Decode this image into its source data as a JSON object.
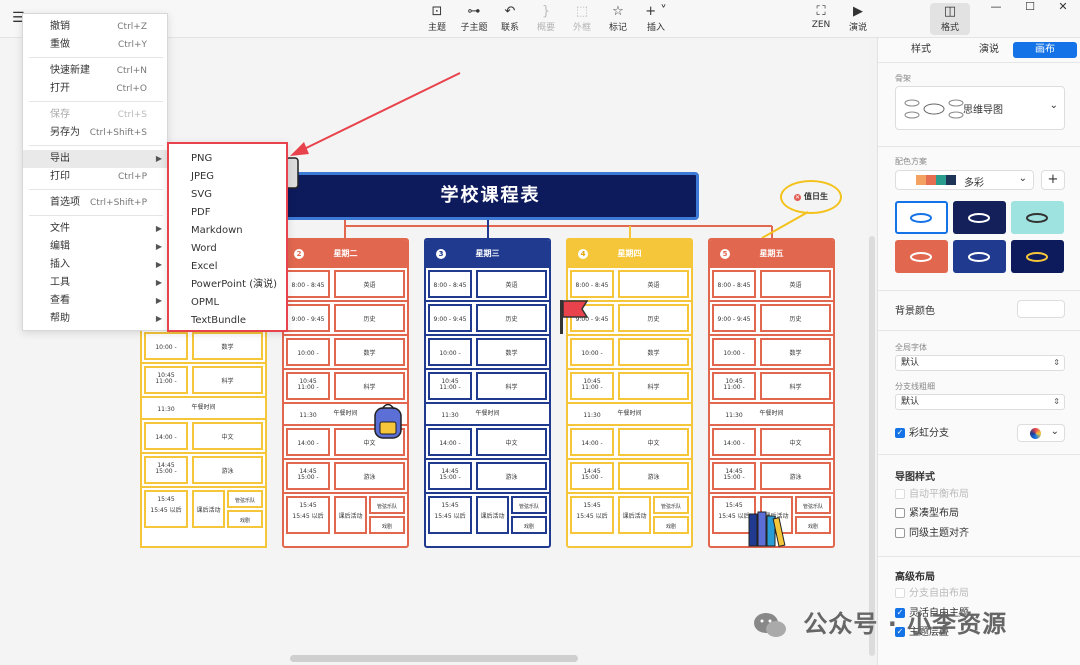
{
  "toolbar": {
    "buttons": [
      {
        "label": "主题",
        "icon": "topic-icon"
      },
      {
        "label": "子主题",
        "icon": "subtopic-icon"
      },
      {
        "label": "联系",
        "icon": "relationship-icon"
      },
      {
        "label": "概要",
        "icon": "summary-icon"
      },
      {
        "label": "外框",
        "icon": "boundary-icon"
      },
      {
        "label": "标记",
        "icon": "marker-icon"
      },
      {
        "label": "插入",
        "icon": "insert-icon"
      },
      {
        "label": "ZEN",
        "icon": "zen-icon"
      },
      {
        "label": "演说",
        "icon": "pitch-icon"
      },
      {
        "label": "格式",
        "icon": "format-icon"
      }
    ]
  },
  "menu": {
    "items": [
      {
        "label": "撤销",
        "shortcut": "Ctrl+Z"
      },
      {
        "label": "重做",
        "shortcut": "Ctrl+Y"
      },
      {
        "label": "快速新建",
        "shortcut": "Ctrl+N"
      },
      {
        "label": "打开",
        "shortcut": "Ctrl+O"
      },
      {
        "label": "保存",
        "shortcut": "Ctrl+S"
      },
      {
        "label": "另存为",
        "shortcut": "Ctrl+Shift+S"
      },
      {
        "label": "导出",
        "shortcut": ""
      },
      {
        "label": "打印",
        "shortcut": "Ctrl+P"
      },
      {
        "label": "首选项",
        "shortcut": "Ctrl+Shift+P"
      },
      {
        "label": "文件",
        "shortcut": ""
      },
      {
        "label": "编辑",
        "shortcut": ""
      },
      {
        "label": "插入",
        "shortcut": ""
      },
      {
        "label": "工具",
        "shortcut": ""
      },
      {
        "label": "查看",
        "shortcut": ""
      },
      {
        "label": "帮助",
        "shortcut": ""
      }
    ]
  },
  "export_submenu": {
    "items": [
      "PNG",
      "JPEG",
      "SVG",
      "PDF",
      "Markdown",
      "Word",
      "Excel",
      "PowerPoint (演说)",
      "OPML",
      "TextBundle"
    ]
  },
  "canvas": {
    "title": "学校课程表",
    "callout": "值日生",
    "days": [
      {
        "num": "2",
        "name": "星期二"
      },
      {
        "num": "3",
        "name": "星期三"
      },
      {
        "num": "4",
        "name": "星期四"
      },
      {
        "num": "5",
        "name": "星期五"
      }
    ],
    "times": [
      "8:00 - 8:45",
      "9:00 - 9:45",
      "10:00 - 10:45",
      "11:00 - 11:30",
      "14:00 - 14:45",
      "15:00 - 15:45",
      "15:45 以后"
    ],
    "subjects": [
      "英语",
      "历史",
      "数学",
      "科学",
      "中文",
      "游泳"
    ],
    "lunch": "午餐时间",
    "after": [
      "课后活动",
      "管弦乐队",
      "戏剧"
    ]
  },
  "panel": {
    "tabs": [
      "样式",
      "演说",
      "画布"
    ],
    "skeleton_label": "骨架",
    "skeleton_value": "思维导图",
    "color_label": "配色方案",
    "color_value": "多彩",
    "color_swatches": [
      "#f4a261",
      "#e76f51",
      "#2a9d8f",
      "#264653",
      "#1d3557",
      "#e9c46a",
      "#1473e6"
    ],
    "bg_label": "背景颜色",
    "font_label": "全局字体",
    "font_value": "默认",
    "branch_label": "分支线粗细",
    "branch_value": "默认",
    "rainbow_label": "彩虹分支",
    "map_style_label": "导图样式",
    "auto_balance": "自动平衡布局",
    "compact": "紧凑型布局",
    "align": "同级主题对齐",
    "advanced_label": "高级布局",
    "free_layout": "分支自由布局",
    "flexible": "灵活自由主题",
    "overlap": "主题层叠"
  },
  "watermark": "公众号 · 小李资源"
}
